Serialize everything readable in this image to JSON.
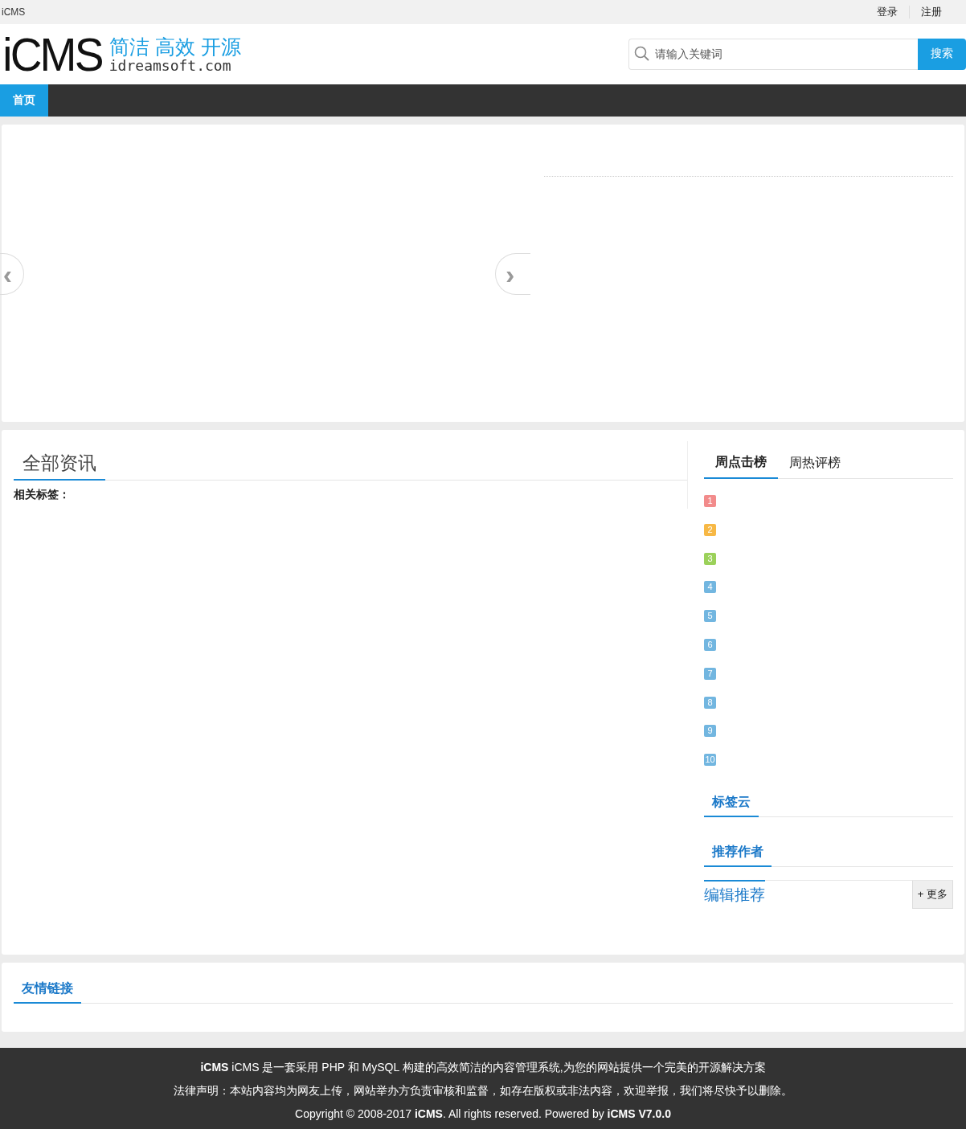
{
  "topbar": {
    "site_name": "iCMS",
    "links": [
      "登录",
      "注册"
    ]
  },
  "header": {
    "logo": {
      "wordmark": "iCMS",
      "slogan": "简洁 高效 开源",
      "domain": "idreamsoft.com"
    },
    "search": {
      "placeholder": "请输入关键词",
      "button": "搜索"
    }
  },
  "nav": [
    {
      "label": "首页",
      "selected": true
    }
  ],
  "slider": {
    "prev": "‹",
    "next": "›"
  },
  "main": {
    "title": "全部资讯",
    "tags_label": "相关标签："
  },
  "sidebar": {
    "tabs": [
      {
        "label": "周点击榜",
        "selected": true
      },
      {
        "label": "周热评榜",
        "selected": false
      }
    ],
    "ranking": [
      {
        "rank": "1",
        "color": "#f28b8b"
      },
      {
        "rank": "2",
        "color": "#f7b845"
      },
      {
        "rank": "3",
        "color": "#9bd15a"
      },
      {
        "rank": "4",
        "color": "#72b6e0"
      },
      {
        "rank": "5",
        "color": "#72b6e0"
      },
      {
        "rank": "6",
        "color": "#72b6e0"
      },
      {
        "rank": "7",
        "color": "#72b6e0"
      },
      {
        "rank": "8",
        "color": "#72b6e0"
      },
      {
        "rank": "9",
        "color": "#72b6e0"
      },
      {
        "rank": "10",
        "color": "#72b6e0"
      }
    ],
    "sections": [
      {
        "title": "标签云"
      },
      {
        "title": "推荐作者"
      }
    ],
    "editor_pick": {
      "title": "编辑推荐",
      "more": "+ 更多"
    }
  },
  "links_panel": {
    "title": "友情链接"
  },
  "footer": {
    "lines": [
      "**iCMS** iCMS 是一套采用 PHP 和 MySQL 构建的高效简洁的内容管理系统,为您的网站提供一个完美的开源解决方案",
      "法律声明：本站内容均为网友上传，网站举办方负责审核和监督，如存在版权或非法内容，欢迎举报，我们将尽快予以删除。",
      "Copyright © 2008-2017 **iCMS**. All rights reserved. Powered by **iCMS V7.0.0**"
    ]
  }
}
